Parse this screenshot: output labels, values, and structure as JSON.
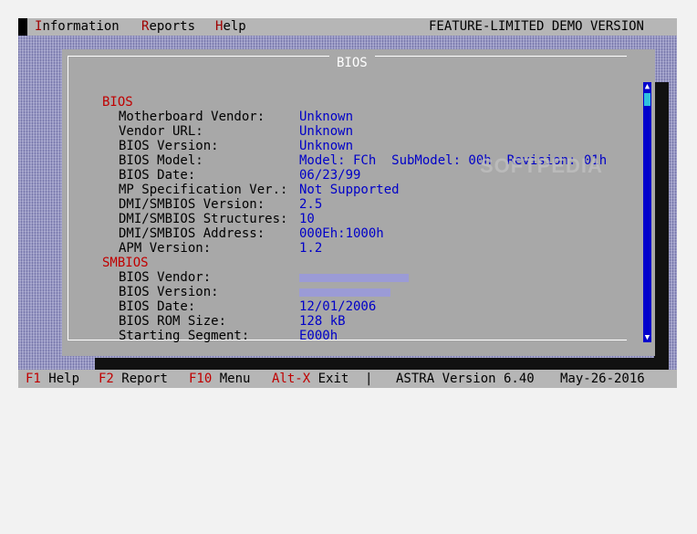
{
  "menu": {
    "items": [
      {
        "hot": "I",
        "rest": "nformation"
      },
      {
        "hot": "R",
        "rest": "eports"
      },
      {
        "hot": "H",
        "rest": "elp"
      }
    ],
    "demo_label": "FEATURE-LIMITED DEMO VERSION"
  },
  "window": {
    "title": "BIOS"
  },
  "sections": [
    {
      "title": "BIOS",
      "rows": [
        {
          "label": "Motherboard Vendor:",
          "value": "Unknown"
        },
        {
          "label": "Vendor URL:",
          "value": "Unknown"
        },
        {
          "label": "BIOS Version:",
          "value": "Unknown"
        },
        {
          "label": "BIOS Model:",
          "value": "Model: FCh  SubModel: 00h  Revision: 01h"
        },
        {
          "label": "BIOS Date:",
          "value": "06/23/99"
        },
        {
          "label": "MP Specification Ver.:",
          "value": "Not Supported"
        },
        {
          "label": "DMI/SMBIOS Version:",
          "value": "2.5"
        },
        {
          "label": "DMI/SMBIOS Structures:",
          "value": "10"
        },
        {
          "label": "DMI/SMBIOS Address:",
          "value": "000Eh:1000h"
        },
        {
          "label": "APM Version:",
          "value": "1.2"
        }
      ]
    },
    {
      "title": "SMBIOS",
      "rows": [
        {
          "label": "BIOS Vendor:",
          "value": ""
        },
        {
          "label": "BIOS Version:",
          "value": ""
        },
        {
          "label": "BIOS Date:",
          "value": "12/01/2006"
        },
        {
          "label": "BIOS ROM Size:",
          "value": "128 kB"
        },
        {
          "label": "Starting Segment:",
          "value": "E000h"
        }
      ]
    }
  ],
  "watermark": "SOFTPEDIA",
  "statusbar": {
    "f1_key": "F1",
    "f1_label": "Help",
    "f2_key": "F2",
    "f2_label": "Report",
    "f10_key": "F10",
    "f10_label": "Menu",
    "altx_key": "Alt-X",
    "altx_label": "Exit",
    "separator": "|",
    "version": "ASTRA Version 6.40",
    "date": "May-26-2016"
  },
  "colors": {
    "background": "#9a9ac6",
    "window": "#a8a8a8",
    "section": "#c00000",
    "value": "#0000c8",
    "scrollbar": "#0000cc",
    "scroll_thumb": "#2ec0e0"
  }
}
